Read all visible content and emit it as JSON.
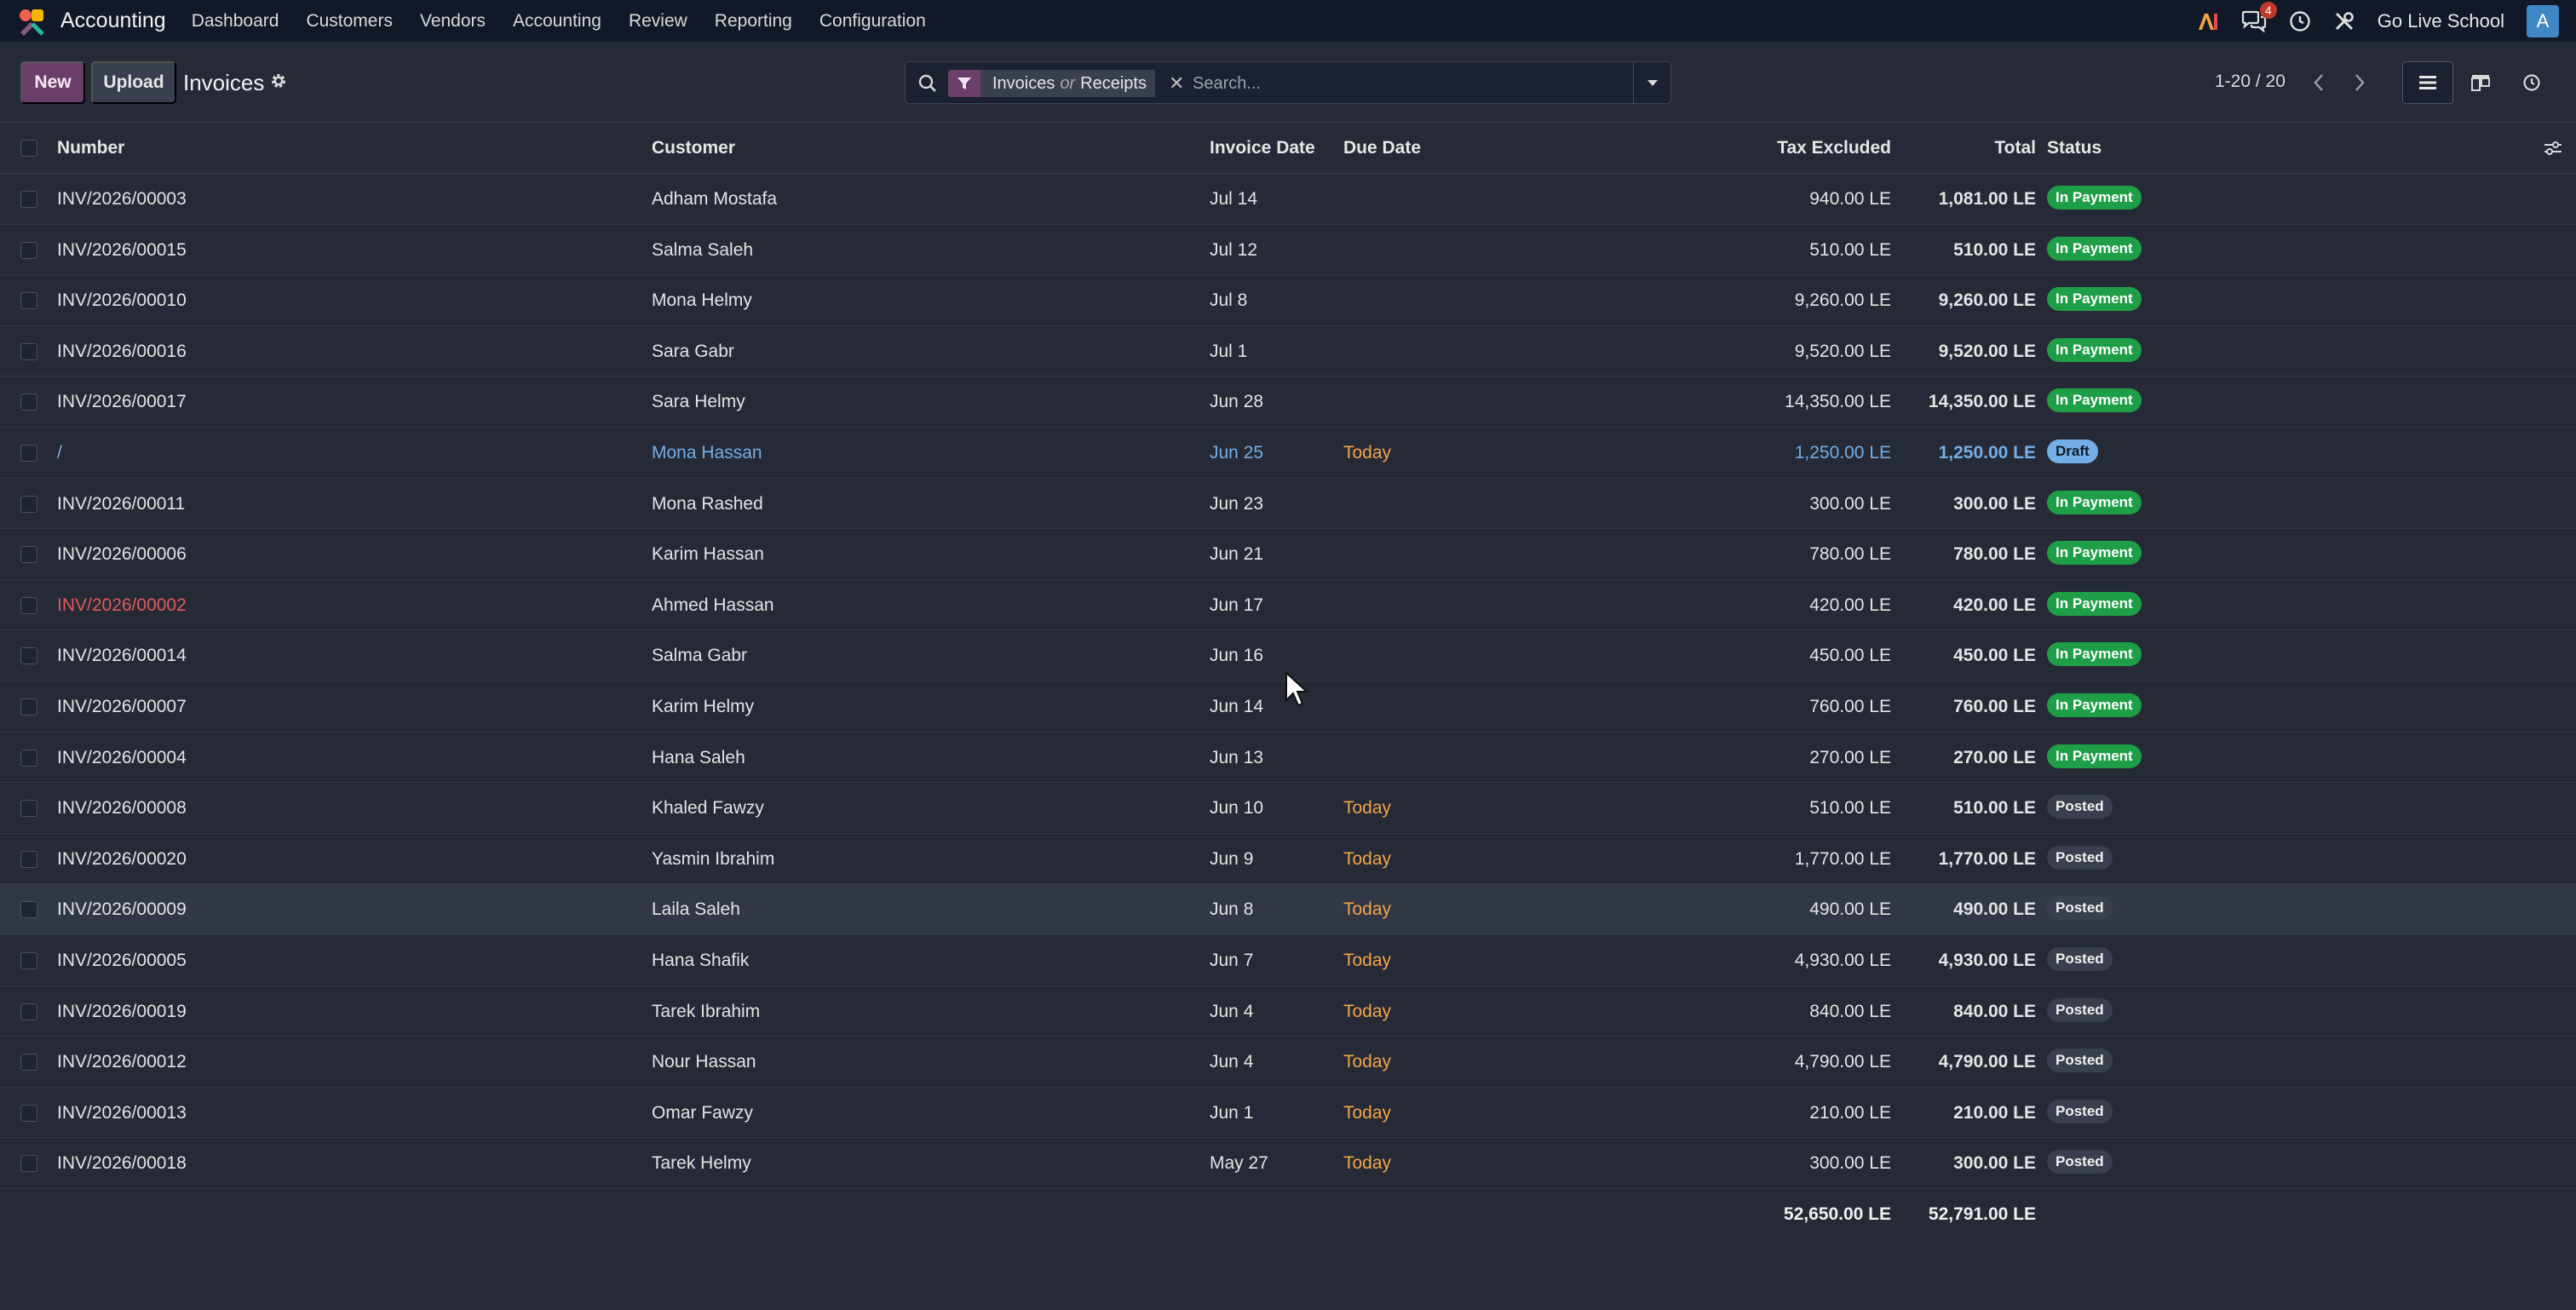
{
  "topnav": {
    "app_name": "Accounting",
    "menu": [
      "Dashboard",
      "Customers",
      "Vendors",
      "Accounting",
      "Review",
      "Reporting",
      "Configuration"
    ],
    "messages_count": "4",
    "company": "Go Live School",
    "avatar_letter": "A"
  },
  "control": {
    "new_label": "New",
    "upload_label": "Upload",
    "title": "Invoices",
    "facet_a": "Invoices",
    "facet_or": "or",
    "facet_b": "Receipts",
    "search_placeholder": "Search...",
    "pager": "1-20 / 20"
  },
  "table": {
    "headers": {
      "number": "Number",
      "customer": "Customer",
      "invoice_date": "Invoice Date",
      "due_date": "Due Date",
      "tax_excluded": "Tax Excluded",
      "total": "Total",
      "status": "Status"
    },
    "rows": [
      {
        "number": "INV/2026/00003",
        "customer": "Adham Mostafa",
        "date": "Jul 14",
        "due": "",
        "tax": "940.00 LE",
        "total": "1,081.00 LE",
        "status": "In Payment"
      },
      {
        "number": "INV/2026/00015",
        "customer": "Salma Saleh",
        "date": "Jul 12",
        "due": "",
        "tax": "510.00 LE",
        "total": "510.00 LE",
        "status": "In Payment"
      },
      {
        "number": "INV/2026/00010",
        "customer": "Mona Helmy",
        "date": "Jul 8",
        "due": "",
        "tax": "9,260.00 LE",
        "total": "9,260.00 LE",
        "status": "In Payment"
      },
      {
        "number": "INV/2026/00016",
        "customer": "Sara Gabr",
        "date": "Jul 1",
        "due": "",
        "tax": "9,520.00 LE",
        "total": "9,520.00 LE",
        "status": "In Payment"
      },
      {
        "number": "INV/2026/00017",
        "customer": "Sara Helmy",
        "date": "Jun 28",
        "due": "",
        "tax": "14,350.00 LE",
        "total": "14,350.00 LE",
        "status": "In Payment"
      },
      {
        "number": "/",
        "customer": "Mona Hassan",
        "date": "Jun 25",
        "due": "Today",
        "tax": "1,250.00 LE",
        "total": "1,250.00 LE",
        "status": "Draft"
      },
      {
        "number": "INV/2026/00011",
        "customer": "Mona Rashed",
        "date": "Jun 23",
        "due": "",
        "tax": "300.00 LE",
        "total": "300.00 LE",
        "status": "In Payment"
      },
      {
        "number": "INV/2026/00006",
        "customer": "Karim Hassan",
        "date": "Jun 21",
        "due": "",
        "tax": "780.00 LE",
        "total": "780.00 LE",
        "status": "In Payment"
      },
      {
        "number": "INV/2026/00002",
        "customer": "Ahmed Hassan",
        "date": "Jun 17",
        "due": "",
        "tax": "420.00 LE",
        "total": "420.00 LE",
        "status": "In Payment"
      },
      {
        "number": "INV/2026/00014",
        "customer": "Salma Gabr",
        "date": "Jun 16",
        "due": "",
        "tax": "450.00 LE",
        "total": "450.00 LE",
        "status": "In Payment"
      },
      {
        "number": "INV/2026/00007",
        "customer": "Karim Helmy",
        "date": "Jun 14",
        "due": "",
        "tax": "760.00 LE",
        "total": "760.00 LE",
        "status": "In Payment"
      },
      {
        "number": "INV/2026/00004",
        "customer": "Hana Saleh",
        "date": "Jun 13",
        "due": "",
        "tax": "270.00 LE",
        "total": "270.00 LE",
        "status": "In Payment"
      },
      {
        "number": "INV/2026/00008",
        "customer": "Khaled Fawzy",
        "date": "Jun 10",
        "due": "Today",
        "tax": "510.00 LE",
        "total": "510.00 LE",
        "status": "Posted"
      },
      {
        "number": "INV/2026/00020",
        "customer": "Yasmin Ibrahim",
        "date": "Jun 9",
        "due": "Today",
        "tax": "1,770.00 LE",
        "total": "1,770.00 LE",
        "status": "Posted"
      },
      {
        "number": "INV/2026/00009",
        "customer": "Laila Saleh",
        "date": "Jun 8",
        "due": "Today",
        "tax": "490.00 LE",
        "total": "490.00 LE",
        "status": "Posted"
      },
      {
        "number": "INV/2026/00005",
        "customer": "Hana Shafik",
        "date": "Jun 7",
        "due": "Today",
        "tax": "4,930.00 LE",
        "total": "4,930.00 LE",
        "status": "Posted"
      },
      {
        "number": "INV/2026/00019",
        "customer": "Tarek Ibrahim",
        "date": "Jun 4",
        "due": "Today",
        "tax": "840.00 LE",
        "total": "840.00 LE",
        "status": "Posted"
      },
      {
        "number": "INV/2026/00012",
        "customer": "Nour Hassan",
        "date": "Jun 4",
        "due": "Today",
        "tax": "4,790.00 LE",
        "total": "4,790.00 LE",
        "status": "Posted"
      },
      {
        "number": "INV/2026/00013",
        "customer": "Omar Fawzy",
        "date": "Jun 1",
        "due": "Today",
        "tax": "210.00 LE",
        "total": "210.00 LE",
        "status": "Posted"
      },
      {
        "number": "INV/2026/00018",
        "customer": "Tarek Helmy",
        "date": "May 27",
        "due": "Today",
        "tax": "300.00 LE",
        "total": "300.00 LE",
        "status": "Posted"
      }
    ],
    "totals": {
      "tax": "52,650.00 LE",
      "total": "52,791.00 LE"
    }
  },
  "icons": {
    "app": "accounting-app-icon",
    "ai": "ai-icon",
    "chat": "chat-icon",
    "activity": "clock-icon",
    "tools": "tools-icon",
    "gear": "gear-icon",
    "search": "search-icon",
    "filter": "filter-icon",
    "optional_columns": "sliders-icon"
  },
  "colors": {
    "background": "#262A36",
    "topbar": "#111827",
    "primary": "#6B3F6A",
    "in_payment": "#1E9E46",
    "draft": "#74AEE6",
    "due_today": "#F0A54A",
    "overdue_number": "#E05B5B"
  }
}
